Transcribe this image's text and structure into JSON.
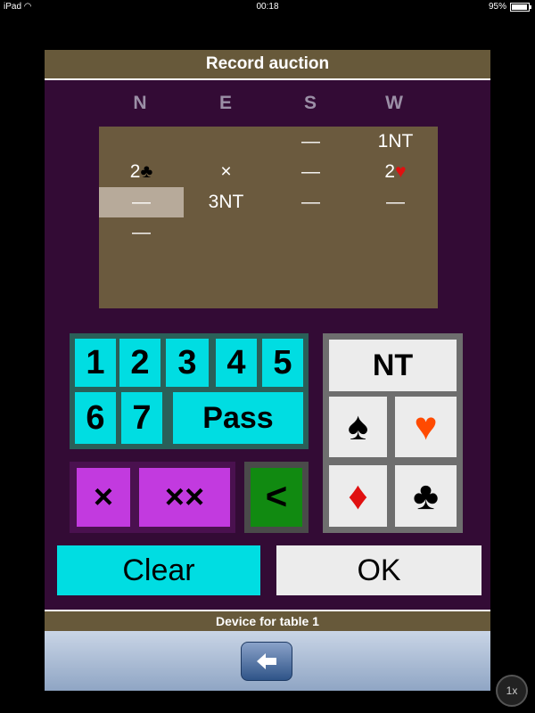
{
  "status": {
    "device": "iPad",
    "time": "00:18",
    "battery": "95%",
    "battery_level": 0.95
  },
  "title": "Record auction",
  "columns": [
    "N",
    "E",
    "S",
    "W"
  ],
  "auction": {
    "rows": [
      [
        "",
        "",
        "—",
        "1NT"
      ],
      [
        "2",
        "×",
        "—",
        "2"
      ],
      [
        "—",
        "3NT",
        "—",
        "—"
      ],
      [
        "—",
        "",
        "",
        ""
      ]
    ],
    "row2_suits": {
      "n": "♣",
      "w": "♥"
    },
    "highlight": {
      "row": 2,
      "col": 0
    }
  },
  "bid_levels": [
    "1",
    "2",
    "3",
    "4",
    "5",
    "6",
    "7"
  ],
  "pass_label": "Pass",
  "suits": {
    "nt": "NT",
    "spade": "♠",
    "heart": "♥",
    "diamond": "♦",
    "club": "♣"
  },
  "double_label": "×",
  "redouble_label": "××",
  "undo_label": "<",
  "clear_label": "Clear",
  "ok_label": "OK",
  "footer": "Device for table 1",
  "zoom": "1x",
  "colors": {
    "accent": "#00dde2",
    "frame": "#330b35",
    "header": "#67593a",
    "double": "#c23adf",
    "undo": "#118a11",
    "red_suit": "#e01010",
    "heart_suit": "#ff4a00"
  }
}
